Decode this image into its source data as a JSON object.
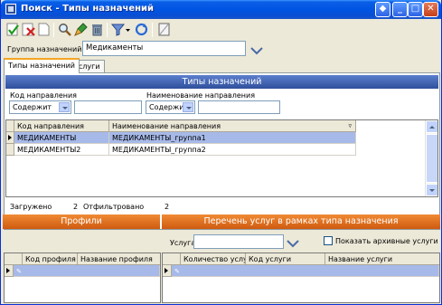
{
  "window": {
    "title": "Поиск - Типы назначений",
    "icons": [
      "app-window-icon",
      "pin-icon",
      "minimize-icon",
      "maximize-icon",
      "close-icon"
    ]
  },
  "toolbar": {
    "icons": [
      "apply-check-icon",
      "delete-x-icon",
      "new-document-icon",
      "search-magnifier-icon",
      "brush-icon",
      "trash-icon",
      "filter-icon",
      "refresh-icon",
      "blank-page-icon"
    ]
  },
  "group": {
    "label": "Группа назначений:",
    "value": "Медикаменты"
  },
  "tabs": [
    {
      "label": "Типы назначений",
      "active": true
    },
    {
      "label": "Услуги",
      "active": false
    }
  ],
  "types_section": {
    "header": "Типы назначений",
    "filter_code_label": "Код направления",
    "filter_code_mode": "Содержит",
    "filter_code_value": "",
    "filter_name_label": "Наименование направления",
    "filter_name_mode": "Содержит",
    "filter_name_value": "",
    "columns": [
      "Код направления",
      "Наименование направления"
    ],
    "rows": [
      {
        "code": "МЕДИКАМЕНТЫ",
        "name": "МЕДИКАМЕНТЫ_группа1",
        "selected": true
      },
      {
        "code": "МЕДИКАМЕНТЫ2",
        "name": "МЕДИКАМЕНТЫ_группа2",
        "selected": false
      }
    ],
    "status_loaded_label": "Загружено",
    "status_loaded_value": "2",
    "status_filtered_label": "Отфильтровано",
    "status_filtered_value": "2"
  },
  "profiles": {
    "header": "Профили",
    "columns": [
      "Код профиля",
      "Название профиля"
    ]
  },
  "services": {
    "header": "Перечень услуг в рамках типа назначения",
    "service_label": "Услуга:",
    "service_value": "",
    "archive_label": "Показать архивные услуги",
    "archive_checked": false,
    "columns": [
      "Количество услуг",
      "Код услуги",
      "Название услуги"
    ]
  },
  "colors": {
    "title_bar": "#0054e3",
    "section_blue": "#3a5ba8",
    "section_orange": "#e07020",
    "selected_row": "#a6b9e8"
  }
}
